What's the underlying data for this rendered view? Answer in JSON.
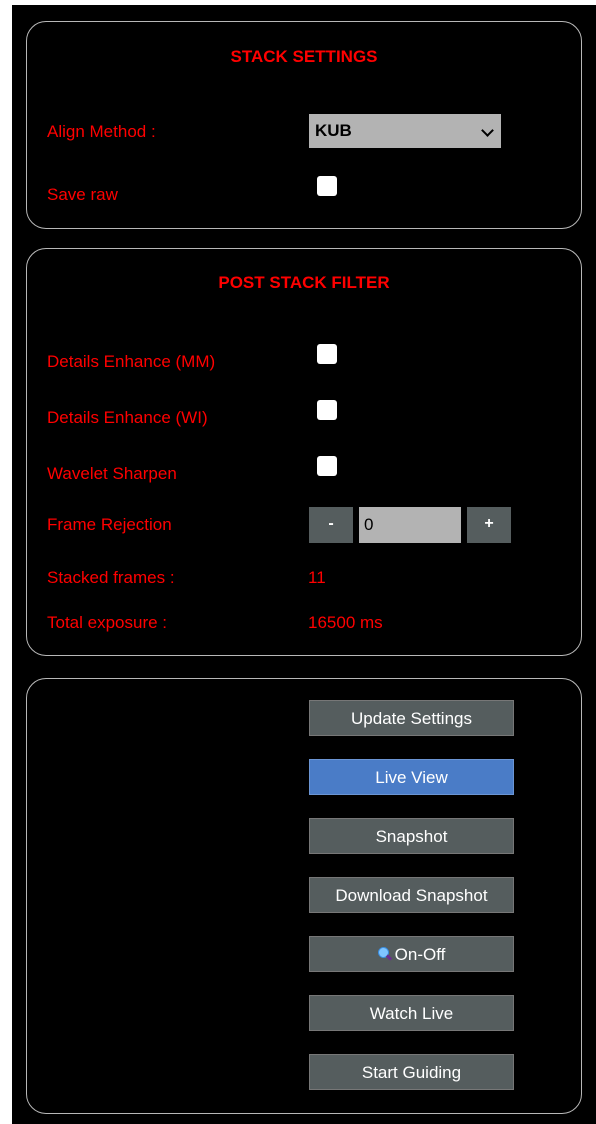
{
  "stack_settings": {
    "title": "STACK SETTINGS",
    "align_method_label": "Align Method :",
    "align_method_value": "KUB",
    "save_raw_label": "Save raw"
  },
  "post_stack_filter": {
    "title": "POST STACK FILTER",
    "details_enhance_mm_label": "Details Enhance (MM)",
    "details_enhance_wi_label": "Details Enhance (WI)",
    "wavelet_sharpen_label": "Wavelet Sharpen",
    "frame_rejection_label": "Frame Rejection",
    "frame_rejection_decrement": "-",
    "frame_rejection_value": "0",
    "frame_rejection_increment": "+",
    "stacked_frames_label": "Stacked frames :",
    "stacked_frames_value": "11",
    "total_exposure_label": "Total exposure :",
    "total_exposure_value": "16500 ms"
  },
  "actions": {
    "update_settings": "Update Settings",
    "live_view": "Live View",
    "snapshot": "Snapshot",
    "download_snapshot": "Download Snapshot",
    "on_off": "On-Off",
    "watch_live": "Watch Live",
    "start_guiding": "Start Guiding"
  },
  "colors": {
    "label_red": "#ff0000",
    "button_gray": "#555d5e",
    "active_blue": "#4a7cc7",
    "background": "#000000"
  },
  "icons": {
    "on_off_icon": "magnifier-icon"
  }
}
